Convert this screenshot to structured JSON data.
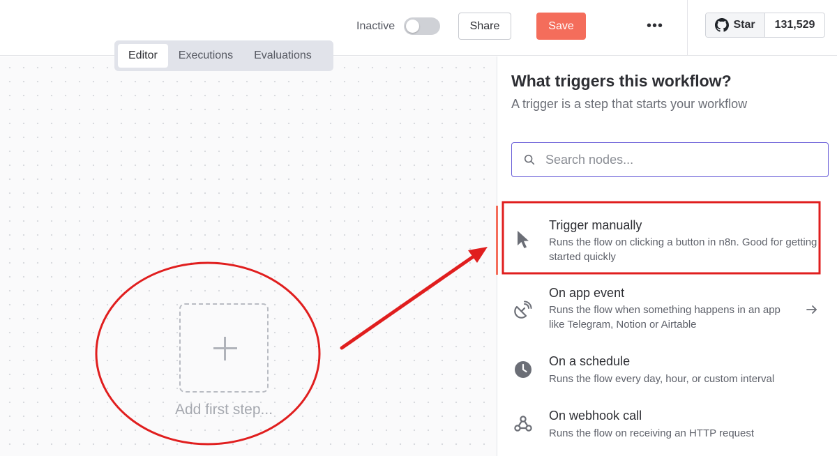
{
  "header": {
    "active_label": "Inactive",
    "share_label": "Share",
    "save_label": "Save",
    "more_label": "•••",
    "github": {
      "star_label": "Star",
      "star_count": "131,529"
    }
  },
  "tabs": [
    {
      "label": "Editor",
      "active": true
    },
    {
      "label": "Executions",
      "active": false
    },
    {
      "label": "Evaluations",
      "active": false
    }
  ],
  "canvas": {
    "add_step_label": "Add first step..."
  },
  "panel": {
    "title": "What triggers this workflow?",
    "subtitle": "A trigger is a step that starts your workflow",
    "search_placeholder": "Search nodes...",
    "items": [
      {
        "title": "Trigger manually",
        "description": "Runs the flow on clicking a button in n8n. Good for getting started quickly",
        "icon": "cursor-icon"
      },
      {
        "title": "On app event",
        "description": "Runs the flow when something happens in an app like Telegram, Notion or Airtable",
        "icon": "satellite-dish-icon"
      },
      {
        "title": "On a schedule",
        "description": "Runs the flow every day, hour, or custom interval",
        "icon": "clock-icon"
      },
      {
        "title": "On webhook call",
        "description": "Runs the flow on receiving an HTTP request",
        "icon": "webhook-icon"
      }
    ]
  },
  "colors": {
    "accent": "#f46d5b",
    "search_border": "#6a5fd8",
    "annotation": "#e01e1e"
  }
}
